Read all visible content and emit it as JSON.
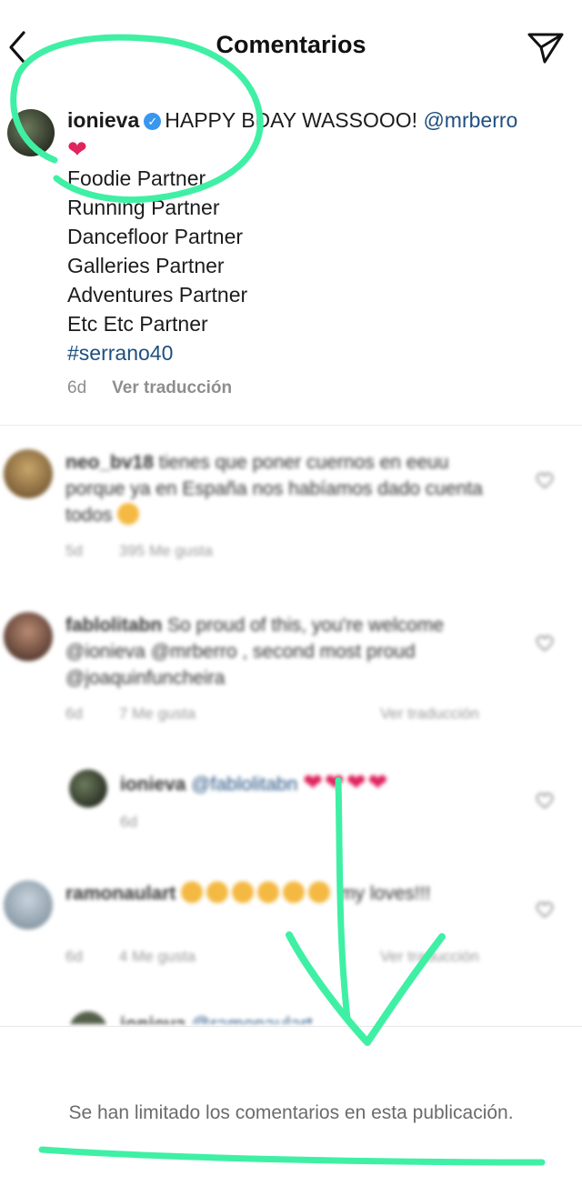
{
  "header": {
    "title": "Comentarios",
    "back_icon": "chevron-left-icon",
    "send_icon": "paper-plane-icon"
  },
  "caption": {
    "username": "ionieva",
    "text": "HAPPY BDAY WASSOOO!",
    "mention": "@mrberro",
    "lines": [
      "Foodie Partner",
      "Running Partner",
      "Dancefloor Partner",
      "Galleries Partner",
      "Adventures Partner",
      "Etc Etc Partner"
    ],
    "hashtag": "#serrano40",
    "time": "6d",
    "translate": "Ver traducción"
  },
  "comments": [
    {
      "username": "neo_bv18",
      "text": "tienes que poner cuernos en eeuu porque ya en España nos habíamos dado cuenta todos",
      "time": "5d",
      "likes": "395 Me gusta"
    },
    {
      "username": "fablolitabn",
      "text": "So proud of this, you're welcome @ionieva @mrberro , second most proud @joaquinfuncheira",
      "time": "6d",
      "likes": "7 Me gusta",
      "translate": "Ver traducción"
    },
    {
      "username": "ionieva",
      "text": "@fablolitabn",
      "time": "6d"
    },
    {
      "username": "ramonaulart",
      "text": "my loves!!!",
      "time": "6d",
      "likes": "4 Me gusta",
      "translate": "Ver traducción"
    },
    {
      "username": "ionieva",
      "text": "@ramonaulart"
    }
  ],
  "footer": {
    "limited_text": "Se han limitado los comentarios en esta publicación."
  },
  "colors": {
    "annotation": "#3ff0a4",
    "verified": "#3897f0",
    "link": "#1f4f7f",
    "heart": "#e0245e"
  }
}
